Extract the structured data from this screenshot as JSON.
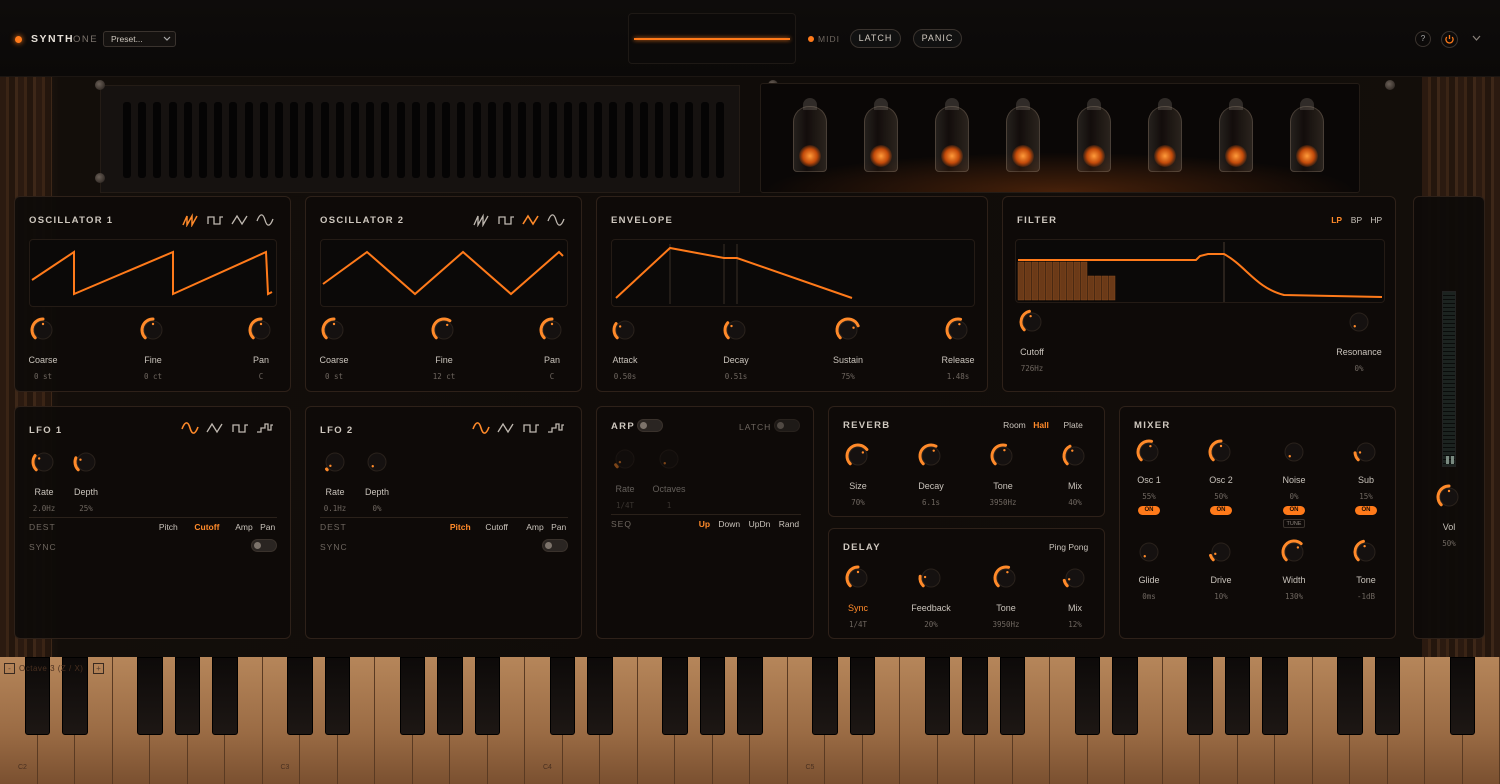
{
  "app": {
    "brand": "SYNTH",
    "brand_sub": "ONE",
    "preset": "Preset...",
    "midi_label": "MIDI",
    "latch": "LATCH",
    "panic": "PANIC",
    "help": "?"
  },
  "colors": {
    "accent": "#ff8a2a",
    "panel_bg": "#0e0b09",
    "border": "#2e2119",
    "text": "#c9c4bd",
    "muted": "#6f6760"
  },
  "osc1": {
    "title": "OSCILLATOR 1",
    "knobs": [
      {
        "label": "Coarse",
        "value": "0 st"
      },
      {
        "label": "Fine",
        "value": "0 ct"
      },
      {
        "label": "Pan",
        "value": "C"
      }
    ],
    "active_wave": "saw"
  },
  "osc2": {
    "title": "OSCILLATOR 2",
    "knobs": [
      {
        "label": "Coarse",
        "value": "0 st"
      },
      {
        "label": "Fine",
        "value": "12 ct"
      },
      {
        "label": "Pan",
        "value": "C"
      }
    ],
    "active_wave": "triangle"
  },
  "envelope": {
    "title": "ENVELOPE",
    "knobs": [
      {
        "label": "Attack",
        "value": "0.50s"
      },
      {
        "label": "Decay",
        "value": "0.51s"
      },
      {
        "label": "Sustain",
        "value": "75%"
      },
      {
        "label": "Release",
        "value": "1.48s"
      }
    ]
  },
  "filter": {
    "title": "FILTER",
    "modes": [
      "LP",
      "BP",
      "HP"
    ],
    "active_mode": "LP",
    "knobs": [
      {
        "label": "Cutoff",
        "value": "726Hz"
      },
      {
        "label": "Resonance",
        "value": "0%"
      }
    ]
  },
  "lfo1": {
    "title": "LFO 1",
    "knobs": [
      {
        "label": "Rate",
        "value": "2.0Hz"
      },
      {
        "label": "Depth",
        "value": "25%"
      }
    ],
    "dest_label": "DEST",
    "dest": [
      "Pitch",
      "Cutoff",
      "Amp",
      "Pan"
    ],
    "active_dest": "Cutoff",
    "sync_label": "SYNC"
  },
  "lfo2": {
    "title": "LFO 2",
    "knobs": [
      {
        "label": "Rate",
        "value": "0.1Hz"
      },
      {
        "label": "Depth",
        "value": "0%"
      }
    ],
    "dest_label": "DEST",
    "dest": [
      "Pitch",
      "Cutoff",
      "Amp",
      "Pan"
    ],
    "active_dest": "Pitch",
    "sync_label": "SYNC"
  },
  "arp": {
    "title": "ARP",
    "latch": "LATCH",
    "knobs": [
      {
        "label": "Rate",
        "value": "1/4T"
      },
      {
        "label": "Octaves",
        "value": "1"
      }
    ],
    "seq_label": "SEQ",
    "modes": [
      "Up",
      "Down",
      "UpDn",
      "Rand"
    ],
    "active_mode": "Up"
  },
  "reverb": {
    "title": "REVERB",
    "types": [
      "Room",
      "Hall",
      "Plate"
    ],
    "active_type": "Hall",
    "knobs": [
      {
        "label": "Size",
        "value": "70%"
      },
      {
        "label": "Decay",
        "value": "6.1s"
      },
      {
        "label": "Tone",
        "value": "3950Hz"
      },
      {
        "label": "Mix",
        "value": "40%"
      }
    ]
  },
  "delay": {
    "title": "DELAY",
    "mode": "Ping Pong",
    "knobs": [
      {
        "label": "Sync",
        "value": "1/4T"
      },
      {
        "label": "Feedback",
        "value": "20%"
      },
      {
        "label": "Tone",
        "value": "3950Hz"
      },
      {
        "label": "Mix",
        "value": "12%"
      }
    ]
  },
  "mixer": {
    "title": "MIXER",
    "row1": [
      {
        "label": "Osc 1",
        "value": "55%",
        "btn": "ON"
      },
      {
        "label": "Osc 2",
        "value": "50%",
        "btn": "ON"
      },
      {
        "label": "Noise",
        "value": "0%",
        "btn": "ON",
        "extra": "TUNE"
      },
      {
        "label": "Sub",
        "value": "15%",
        "btn": "ON"
      }
    ],
    "row2": [
      {
        "label": "Glide",
        "value": "0ms"
      },
      {
        "label": "Drive",
        "value": "10%"
      },
      {
        "label": "Width",
        "value": "130%"
      },
      {
        "label": "Tone",
        "value": "-1dB"
      }
    ]
  },
  "master": {
    "label": "Vol",
    "value": "50%"
  },
  "keyboard": {
    "octave_label": "Octave 3 (Z / X)",
    "minus": "-",
    "plus": "+",
    "notes": [
      "C2",
      "C3",
      "C4",
      "C5"
    ]
  }
}
